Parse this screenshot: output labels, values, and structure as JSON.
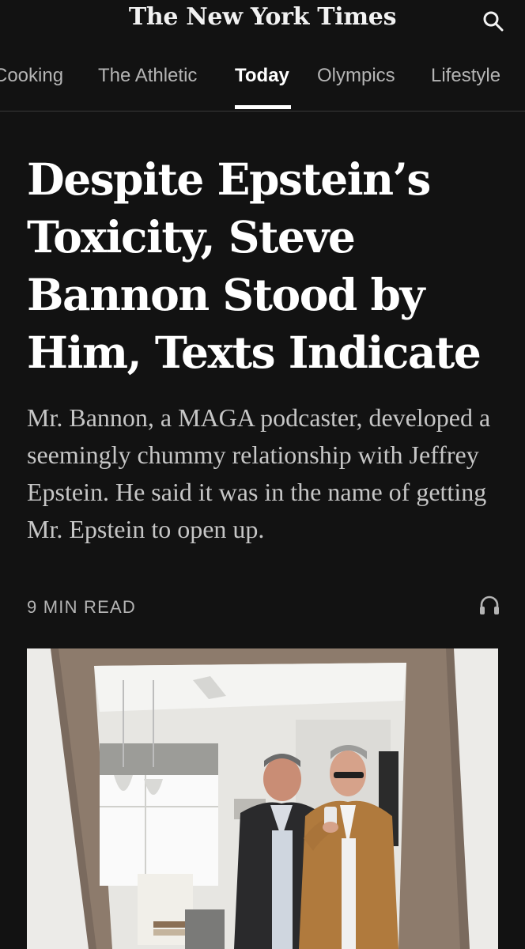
{
  "masthead": {
    "brand": "The New York Times",
    "search_icon": "search-icon"
  },
  "nav": {
    "items": [
      {
        "label": "Cooking",
        "active": false
      },
      {
        "label": "The Athletic",
        "active": false
      },
      {
        "label": "Today",
        "active": true
      },
      {
        "label": "Olympics",
        "active": false
      },
      {
        "label": "Lifestyle",
        "active": false
      }
    ]
  },
  "article": {
    "headline": "Despite Epstein’s Toxicity, Steve Bannon Stood by Him, Texts Indicate",
    "summary": "Mr. Bannon, a MAGA podcaster, developed a seemingly chummy relationship with Jeffrey Epstein. He said it was in the name of getting Mr. Epstein to open up.",
    "read_time": "9 MIN READ",
    "listen_icon": "headphones-icon",
    "image_subject": "mirror-selfie-photo"
  },
  "colors": {
    "background": "#121212",
    "headline": "#ffffff",
    "summary": "#c6c6c6",
    "muted": "#b4b4b4"
  }
}
